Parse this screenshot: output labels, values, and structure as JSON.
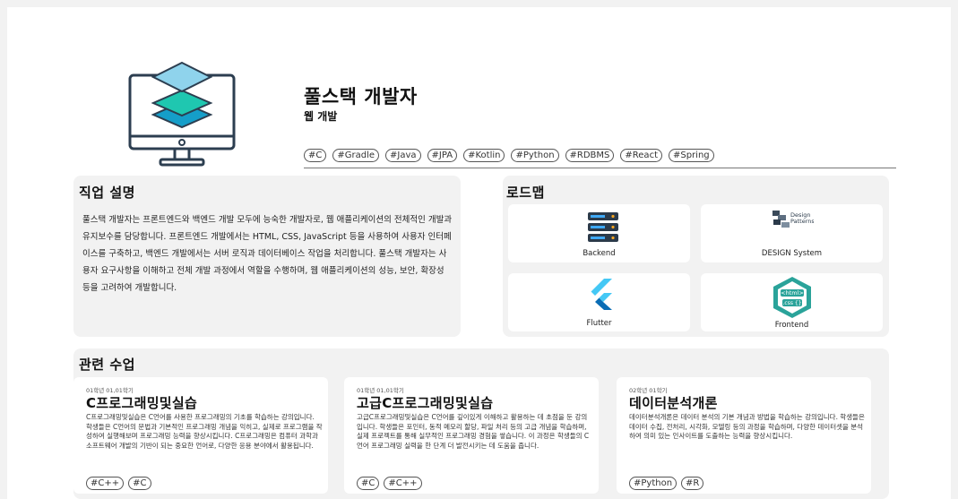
{
  "hero": {
    "title": "풀스택 개발자",
    "category": "웹 개발",
    "tags": [
      "#C",
      "#Gradle",
      "#Java",
      "#JPA",
      "#Kotlin",
      "#Python",
      "#RDBMS",
      "#React",
      "#Spring"
    ],
    "illustration_icon": "monitor-layers-icon"
  },
  "description": {
    "title": "직업 설명",
    "text": "풀스택 개발자는 프론트엔드와 백엔드 개발 모두에 능숙한 개발자로, 웹 애플리케이션의 전체적인 개발과 유지보수를 담당합니다. 프론트엔드 개발에서는 HTML, CSS, JavaScript 등을 사용하여 사용자 인터페이스를 구축하고, 백엔드 개발에서는 서버 로직과 데이터베이스 작업을 처리합니다. 풀스택 개발자는 사용자 요구사항을 이해하고 전체 개발 과정에서 역할을 수행하며, 웹 애플리케이션의 성능, 보안, 확장성 등을 고려하여 개발합니다."
  },
  "roadmap": {
    "title": "로드맵",
    "items": [
      {
        "label": "Backend",
        "icon": "server-stack-icon"
      },
      {
        "label": "DESIGN System",
        "icon": "design-patterns-icon",
        "logo_text": [
          "Design",
          "Patterns"
        ]
      },
      {
        "label": "Flutter",
        "icon": "flutter-logo-icon"
      },
      {
        "label": "Frontend",
        "icon": "html-css-hex-icon",
        "logo_text": [
          "<html>",
          ".css {}"
        ]
      }
    ]
  },
  "courses": {
    "title": "관련 수업",
    "items": [
      {
        "term": "01학년 01,01학기",
        "title": "C프로그래밍및실습",
        "description": "C프로그래밍및실습은 C언어를 사용한 프로그래밍의 기초를 학습하는 강의입니다. 학생들은 C언어의 문법과 기본적인 프로그래밍 개념을 익히고, 실제로 프로그램을 작성하여 실행해보며 프로그래밍 능력을 향상시킵니다. C프로그래밍은 컴퓨터 과학과 소프트웨어 개발의 기반이 되는 중요한 언어로, 다양한 응용 분야에서 활용됩니다.",
        "tags": [
          "#C++",
          "#C"
        ]
      },
      {
        "term": "01학년 01,01학기",
        "title": "고급C프로그래밍및실습",
        "description": "고급C프로그래밍및실습은 C언어를 깊이있게 이해하고 활용하는 데 초점을 둔 강의입니다. 학생들은 포인터, 동적 메모리 할당, 파일 처리 등의 고급 개념을 학습하며, 실제 프로젝트를 통해 실무적인 프로그래밍 경험을 쌓습니다. 이 과정은 학생들의 C언어 프로그래밍 실력을 한 단계 더 발전시키는 데 도움을 줍니다.",
        "tags": [
          "#C",
          "#C++"
        ]
      },
      {
        "term": "02학년 01학기",
        "title": "데이터분석개론",
        "description": "데이터분석개론은 데이터 분석의 기본 개념과 방법을 학습하는 강의입니다. 학생들은 데이터 수집, 전처리, 시각화, 모델링 등의 과정을 학습하며, 다양한 데이터셋을 분석하여 의미 있는 인사이트를 도출하는 능력을 향상시킵니다.",
        "tags": [
          "#Python",
          "#R"
        ]
      }
    ]
  },
  "colors": {
    "layer_top": "#8fd3ec",
    "layer_mid": "#1fc7b0",
    "layer_bottom": "#159ec9",
    "flutter_light": "#44c8f5",
    "flutter_dark": "#0a6db5",
    "frontend_teal": "#2aa39a"
  }
}
